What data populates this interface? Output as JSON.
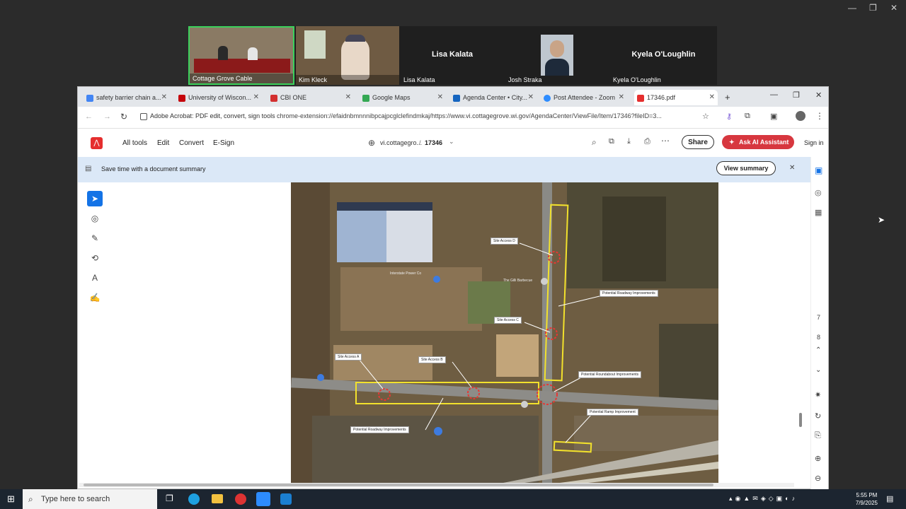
{
  "zoom_window": {
    "minimize": "—",
    "restore": "❐",
    "close": "✕"
  },
  "video": {
    "tiles": [
      {
        "name": "Cottage Grove Cable",
        "kind": "video"
      },
      {
        "name": "Kim Kleck",
        "kind": "video"
      },
      {
        "name": "Lisa Kalata",
        "center": "Lisa Kalata",
        "kind": "name"
      },
      {
        "name": "Josh Straka",
        "kind": "video"
      },
      {
        "name": "Kyela O'Loughlin",
        "center": "Kyela O'Loughlin",
        "kind": "name"
      }
    ]
  },
  "browser": {
    "tabs": [
      {
        "label": "safety barrier chain a...",
        "icon_color": "#4285f4"
      },
      {
        "label": "University of Wiscon...",
        "icon_color": "#c5050c"
      },
      {
        "label": "CBI ONE",
        "icon_color": "#d32f2f"
      },
      {
        "label": "Google Maps",
        "icon_color": "#34a853"
      },
      {
        "label": "Agenda Center • City...",
        "icon_color": "#1565c0"
      },
      {
        "label": "Post Attendee - Zoom",
        "icon_color": "#2d8cff"
      },
      {
        "label": "17346.pdf",
        "icon_color": "#e52e2e",
        "active": true
      }
    ],
    "new_tab": "+",
    "ext_label": "Adobe Acrobat: PDF edit, convert, sign tools",
    "url": "chrome-extension://efaidnbmnnnibpcajpcglclefindmkaj/https://www.vi.cottagegrove.wi.gov/AgendaCenter/ViewFile/Item/17346?fileID=3..."
  },
  "acrobat": {
    "menu": [
      "All tools",
      "Edit",
      "Convert",
      "E-Sign"
    ],
    "breadcrumb_site": "vi.cottagegro...",
    "breadcrumb_sep": "/",
    "doc_name": "17346",
    "share": "Share",
    "ai": "Ask AI Assistant",
    "sign_in": "Sign in",
    "banner_text": "Save time with a document summary",
    "view_summary": "View summary",
    "page_numbers": [
      "7",
      "8"
    ]
  },
  "map_labels": {
    "site_access_d": "Site Access D",
    "site_access_c": "Site Access C",
    "site_access_a": "Site Access A",
    "site_access_b": "Site Access B",
    "roadway_right": "Potential Roadway Improvements",
    "roadway_bottom": "Potential Roadway Improvements",
    "roundabout": "Potential Roundabout Improvements",
    "ramp": "Potential Ramp Improvement",
    "gilli": "The Gilli Barbecue",
    "building": "Interstate Power Co"
  },
  "taskbar": {
    "search": "Type here to search",
    "time": "5:55 PM",
    "date": "7/9/2025"
  }
}
